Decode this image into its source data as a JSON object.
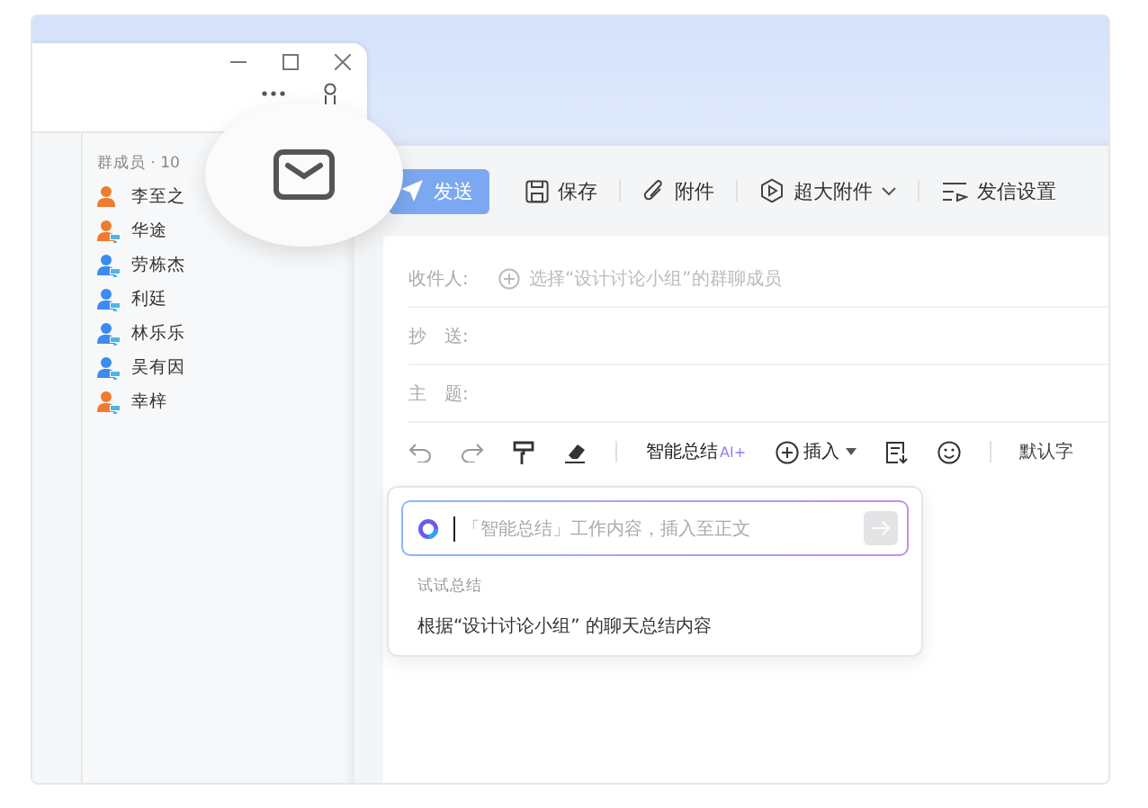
{
  "member_list": {
    "header": "群成员 · 10",
    "members": [
      {
        "name": "李至之",
        "color": "#f07b2c",
        "on_pc": false
      },
      {
        "name": "华途",
        "color": "#f07b2c",
        "on_pc": true
      },
      {
        "name": "劳栋杰",
        "color": "#3b8bf0",
        "on_pc": true
      },
      {
        "name": "利廷",
        "color": "#3b8bf0",
        "on_pc": true
      },
      {
        "name": "林乐乐",
        "color": "#3b8bf0",
        "on_pc": true
      },
      {
        "name": "吴有因",
        "color": "#3b8bf0",
        "on_pc": true
      },
      {
        "name": "幸梓",
        "color": "#f07b2c",
        "on_pc": true
      }
    ]
  },
  "compose": {
    "toolbar": [
      {
        "label": "发送",
        "kind": "primary",
        "dropdown": false
      },
      {
        "label": "保存",
        "kind": "plain",
        "dropdown": false
      },
      {
        "label": "附件",
        "kind": "plain",
        "dropdown": false
      },
      {
        "label": "超大附件",
        "kind": "plain",
        "dropdown": true
      },
      {
        "label": "发信设置",
        "kind": "plain",
        "dropdown": false
      }
    ],
    "fields": [
      {
        "label": "收件人:",
        "placeholder": "选择“设计讨论小组”的群聊成员"
      },
      {
        "label": "抄　送:"
      },
      {
        "label": "主　题:"
      }
    ],
    "format_toolbar": {
      "smart_summary": "智能总结",
      "ai_badge": "AI+",
      "insert": "插入",
      "font": "默认字"
    },
    "ai_popup": {
      "placeholder": "「智能总结」工作内容，插入至正文",
      "hint_title": "试试总结",
      "suggestion": "根据“设计讨论小组” 的聊天总结内容"
    }
  }
}
